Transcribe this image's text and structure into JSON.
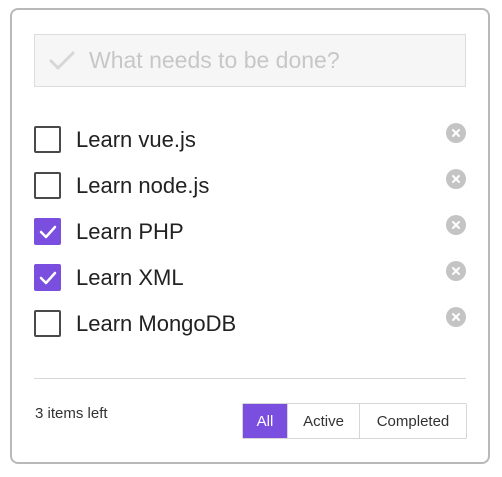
{
  "new_todo": {
    "placeholder": "What needs to be done?",
    "value": ""
  },
  "todos": [
    {
      "label": "Learn vue.js",
      "completed": false
    },
    {
      "label": "Learn node.js",
      "completed": false
    },
    {
      "label": "Learn PHP",
      "completed": true
    },
    {
      "label": "Learn XML",
      "completed": true
    },
    {
      "label": "Learn MongoDB",
      "completed": false
    }
  ],
  "footer": {
    "items_left": "3 items left",
    "filters": [
      {
        "label": "All",
        "selected": true
      },
      {
        "label": "Active",
        "selected": false
      },
      {
        "label": "Completed",
        "selected": false
      }
    ]
  },
  "colors": {
    "accent": "#7a4fe0",
    "border": "#b9b9b9",
    "destroy_icon": "#c4c4c4"
  },
  "icons": {
    "toggle_all": "check-icon",
    "item_check": "check-icon",
    "destroy": "close-circle-icon"
  }
}
